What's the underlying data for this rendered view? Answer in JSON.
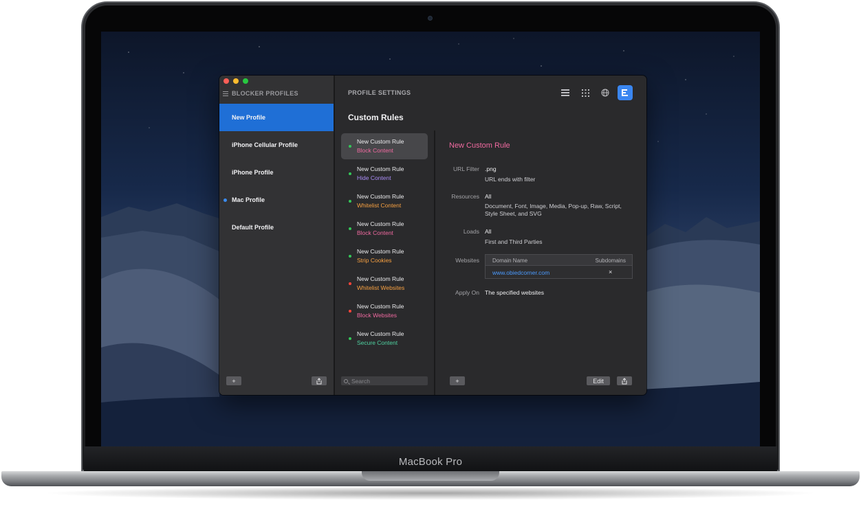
{
  "device": {
    "label": "MacBook Pro"
  },
  "sidebar": {
    "header": "BLOCKER PROFILES",
    "profiles": [
      {
        "label": "New Profile",
        "selected": true,
        "dot": false
      },
      {
        "label": "iPhone Cellular Profile",
        "selected": false,
        "dot": false
      },
      {
        "label": "iPhone Profile",
        "selected": false,
        "dot": false
      },
      {
        "label": "Mac Profile",
        "selected": false,
        "dot": true
      },
      {
        "label": "Default Profile",
        "selected": false,
        "dot": false
      }
    ],
    "add_label": "+",
    "share_label": "⎙"
  },
  "settings": {
    "header": "PROFILE SETTINGS",
    "section_title": "Custom Rules",
    "toolbar_icons": [
      "list-icon",
      "grid-icon",
      "globe-icon",
      "rules-icon"
    ],
    "active_toolbar_icon": "rules-icon"
  },
  "rules": [
    {
      "name": "New Custom Rule",
      "type": "Block Content",
      "type_color": "#f06aa0",
      "dot_color": "#34c759",
      "selected": true
    },
    {
      "name": "New Custom Rule",
      "type": "Hide Content",
      "type_color": "#a98cf5",
      "dot_color": "#34c759",
      "selected": false
    },
    {
      "name": "New Custom Rule",
      "type": "Whitelist Content",
      "type_color": "#f7a041",
      "dot_color": "#34c759",
      "selected": false
    },
    {
      "name": "New Custom Rule",
      "type": "Block Content",
      "type_color": "#f06aa0",
      "dot_color": "#34c759",
      "selected": false
    },
    {
      "name": "New Custom Rule",
      "type": "Strip Cookies",
      "type_color": "#f7a041",
      "dot_color": "#34c759",
      "selected": false
    },
    {
      "name": "New Custom Rule",
      "type": "Whitelist Websites",
      "type_color": "#f7a041",
      "dot_color": "#ff453a",
      "selected": false
    },
    {
      "name": "New Custom Rule",
      "type": "Block Websites",
      "type_color": "#f06aa0",
      "dot_color": "#ff453a",
      "selected": false
    },
    {
      "name": "New Custom Rule",
      "type": "Secure Content",
      "type_color": "#4fd1a0",
      "dot_color": "#34c759",
      "selected": false
    }
  ],
  "search": {
    "placeholder": "Search",
    "value": ""
  },
  "detail": {
    "title": "New Custom Rule",
    "url_filter": {
      "label": "URL Filter",
      "value": ".png",
      "sub": "URL ends with filter"
    },
    "resources": {
      "label": "Resources",
      "value": "All",
      "sub": "Document, Font, Image, Media, Pop-up, Raw, Script, Style Sheet, and SVG"
    },
    "loads": {
      "label": "Loads",
      "value": "All",
      "sub": "First and Third Parties"
    },
    "websites": {
      "label": "Websites",
      "columns": [
        "Domain Name",
        "Subdomains"
      ],
      "rows": [
        {
          "domain": "www.obiedcorner.com",
          "subdomains": "×"
        }
      ]
    },
    "apply_on": {
      "label": "Apply On",
      "value": "The specified websites"
    },
    "add_label": "+",
    "edit_label": "Edit",
    "share_label": "⎙"
  },
  "colors": {
    "accent": "#1f6fd6",
    "window_bg": "#2a2a2c",
    "sidebar_bg": "#323234",
    "link": "#4b9bff"
  }
}
